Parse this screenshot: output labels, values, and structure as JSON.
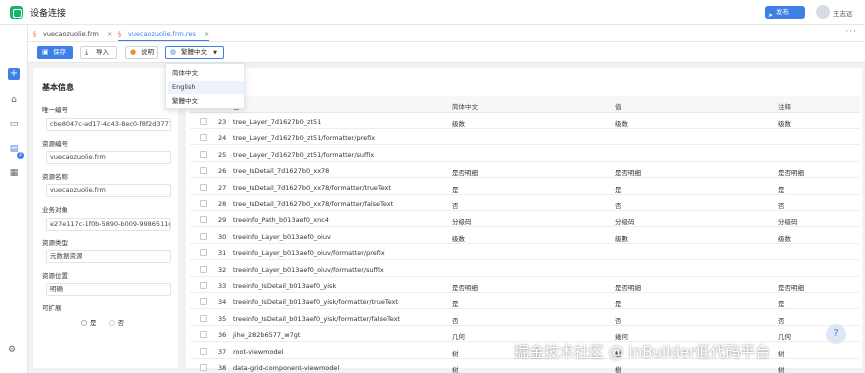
{
  "header": {
    "app_title": "设备连接",
    "publish_label": "发布",
    "user_name": "王志远"
  },
  "tabs": [
    {
      "label": "vuecaozuolie.frm",
      "close": "×"
    },
    {
      "label": "vuecaozuolie.frm.res",
      "close": "×"
    }
  ],
  "more_label": "···",
  "toolbar": {
    "save_label": "保存",
    "import_label": "导入",
    "explain_label": "说明",
    "language_label": "繁體中文"
  },
  "language_menu": {
    "options": [
      "简体中文",
      "English",
      "繁體中文"
    ],
    "highlighted": "English"
  },
  "basic_info": {
    "title": "基本信息",
    "fields": [
      {
        "label": "唯一编号",
        "value": "cbe8047c-ad17-4c43-8ec0-f8f2d377725"
      },
      {
        "label": "资源编号",
        "value": "vuecaozuolie.frm"
      },
      {
        "label": "资源名称",
        "value": "vuecaozuolie.frm"
      },
      {
        "label": "业务对象",
        "value": "e27e117c-1f0b-5890-b009-9986511d65"
      },
      {
        "label": "资源类型",
        "value": "元数据资源"
      },
      {
        "label": "资源位置",
        "value": "明确"
      }
    ],
    "extensible_label": "可扩展",
    "radio_yes": "是",
    "radio_no": "否"
  },
  "table": {
    "headers": {
      "key": "键",
      "zh": "简体中文",
      "value": "值",
      "note": "注释"
    },
    "rows": [
      {
        "num": "23",
        "key": "tree_Layer_7d1627b0_zt51",
        "zh": "级数",
        "value": "级数",
        "note": "级数"
      },
      {
        "num": "24",
        "key": "tree_Layer_7d1627b0_zt51/formatter/prefix",
        "zh": "",
        "value": "",
        "note": ""
      },
      {
        "num": "25",
        "key": "tree_Layer_7d1627b0_zt51/formatter/suffix",
        "zh": "",
        "value": "",
        "note": ""
      },
      {
        "num": "26",
        "key": "tree_IsDetail_7d1627b0_xx78",
        "zh": "是否明细",
        "value": "是否明细",
        "note": "是否明细"
      },
      {
        "num": "27",
        "key": "tree_IsDetail_7d1627b0_xx78/formatter/trueText",
        "zh": "是",
        "value": "是",
        "note": "是"
      },
      {
        "num": "28",
        "key": "tree_IsDetail_7d1627b0_xx78/formatter/falseText",
        "zh": "否",
        "value": "否",
        "note": "否"
      },
      {
        "num": "29",
        "key": "treeinfo_Path_b013aef0_xnc4",
        "zh": "分级码",
        "value": "分级码",
        "note": "分级码"
      },
      {
        "num": "30",
        "key": "treeinfo_Layer_b013aef0_oiuv",
        "zh": "级数",
        "value": "級數",
        "note": "级数"
      },
      {
        "num": "31",
        "key": "treeinfo_Layer_b013aef0_oiuv/formatter/prefix",
        "zh": "",
        "value": "",
        "note": ""
      },
      {
        "num": "32",
        "key": "treeinfo_Layer_b013aef0_oiuv/formatter/suffix",
        "zh": "",
        "value": "",
        "note": ""
      },
      {
        "num": "33",
        "key": "treeinfo_IsDetail_b013aef0_yisk",
        "zh": "是否明细",
        "value": "是否明細",
        "note": "是否明细"
      },
      {
        "num": "34",
        "key": "treeinfo_IsDetail_b013aef0_yisk/formatter/trueText",
        "zh": "是",
        "value": "是",
        "note": "是"
      },
      {
        "num": "35",
        "key": "treeinfo_IsDetail_b013aef0_yisk/formatter/falseText",
        "zh": "否",
        "value": "否",
        "note": "否"
      },
      {
        "num": "36",
        "key": "jihe_282b6577_w7gt",
        "zh": "几何",
        "value": "幾何",
        "note": "几何"
      },
      {
        "num": "37",
        "key": "root-viewmodel",
        "zh": "树",
        "value": "樹",
        "note": "树"
      },
      {
        "num": "38",
        "key": "data-grid-component-viewmodel",
        "zh": "树",
        "value": "樹",
        "note": "树"
      }
    ]
  },
  "watermark": "掘金技术社区 @ inBuilder低代码平台",
  "colors": {
    "accent": "#3f7fe8",
    "logo": "#19b36b"
  },
  "icons": [
    "app-logo-icon",
    "send-icon",
    "plus-icon",
    "home-icon",
    "monitor-icon",
    "document-icon",
    "package-icon",
    "gear-icon",
    "save-icon",
    "import-icon",
    "info-icon",
    "globe-icon",
    "help-icon"
  ]
}
